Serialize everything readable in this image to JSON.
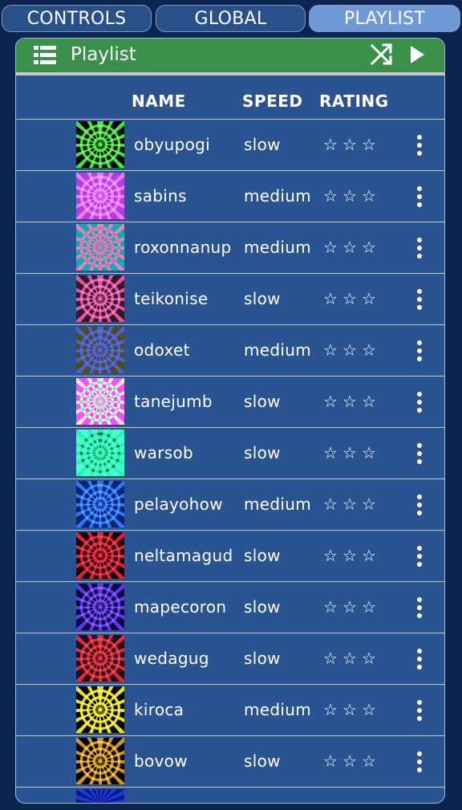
{
  "tabs": [
    {
      "label": "CONTROLS",
      "active": false
    },
    {
      "label": "GLOBAL",
      "active": false
    },
    {
      "label": "PLAYLIST",
      "active": true
    }
  ],
  "header": {
    "title": "Playlist",
    "icons": [
      "list-icon",
      "shuffle-icon",
      "play-icon"
    ]
  },
  "columns": {
    "name": "NAME",
    "speed": "SPEED",
    "rating": "RATING"
  },
  "rows": [
    {
      "name": "obyupogi",
      "speed": "slow",
      "rating": 0,
      "colors": [
        "#000",
        "#43e33b"
      ]
    },
    {
      "name": "sabins",
      "speed": "medium",
      "rating": 0,
      "colors": [
        "#7a1fa8",
        "#d36cf0"
      ]
    },
    {
      "name": "roxonnanup",
      "speed": "medium",
      "rating": 0,
      "colors": [
        "#0b6a7a",
        "#e1306b"
      ]
    },
    {
      "name": "teikonise",
      "speed": "slow",
      "rating": 0,
      "colors": [
        "#1a0e14",
        "#e14a9a"
      ]
    },
    {
      "name": "odoxet",
      "speed": "medium",
      "rating": 0,
      "colors": [
        "#2a2a10",
        "#2c3fd8"
      ]
    },
    {
      "name": "tanejumb",
      "speed": "slow",
      "rating": 0,
      "colors": [
        "#ff2bd6",
        "#1fe86a"
      ]
    },
    {
      "name": "warsob",
      "speed": "slow",
      "rating": 0,
      "colors": [
        "#25ef9b",
        "#083a25"
      ]
    },
    {
      "name": "pelayohow",
      "speed": "medium",
      "rating": 0,
      "colors": [
        "#06123f",
        "#2b6cff"
      ]
    },
    {
      "name": "neltamagud",
      "speed": "slow",
      "rating": 0,
      "colors": [
        "#0a0004",
        "#e0232e"
      ]
    },
    {
      "name": "mapecoron",
      "speed": "slow",
      "rating": 0,
      "colors": [
        "#080425",
        "#5a37e3"
      ]
    },
    {
      "name": "wedagug",
      "speed": "slow",
      "rating": 0,
      "colors": [
        "#140410",
        "#d82a2a"
      ]
    },
    {
      "name": "kiroca",
      "speed": "medium",
      "rating": 0,
      "colors": [
        "#000",
        "#e8e022"
      ]
    },
    {
      "name": "bovow",
      "speed": "slow",
      "rating": 0,
      "colors": [
        "#000",
        "#d3931e"
      ]
    }
  ],
  "partial_thumb_color": "#1f39d6",
  "star_symbol": "☆"
}
